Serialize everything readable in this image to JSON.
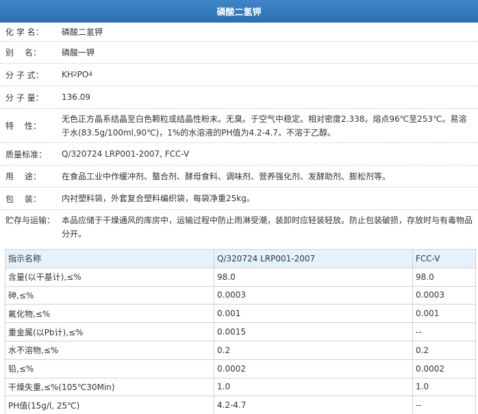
{
  "title": "磷酸二氢钾",
  "info": {
    "chem_name": {
      "label": "化 学 名：",
      "value": "磷酸二氢钾"
    },
    "alias": {
      "label": "别　 名：",
      "value": "磷酸一钾"
    },
    "formula": {
      "label": "分 子 式：",
      "kh": "KH",
      "sub1": "2",
      "po": "PO",
      "sub2": "4"
    },
    "mol_weight": {
      "label": "分 子 量：",
      "value": "136.09"
    },
    "properties": {
      "label": "特　 性：",
      "value": "无色正方晶系结晶至白色颗粒或结晶性粉末。无臭。于空气中稳定。相对密度2.338。熔点96℃至253℃。易溶于水(83.5g/100ml,90℃)，1%的水溶液的PH值为4.2-4.7。不溶于乙醇。"
    },
    "standard": {
      "label": "质量标准：",
      "value": "Q/320724 LRP001-2007, FCC-V"
    },
    "usage": {
      "label": "用　 途：",
      "value": "在食品工业中作缓冲剂、螯合剂、酵母食料、调味剂、营养强化剂、发酵助剂、膨松剂等。"
    },
    "packaging": {
      "label": "包　 装：",
      "value": "内衬塑料袋，外套复合塑料编织袋，每袋净重25kg。"
    },
    "storage": {
      "label": "贮存与运输：",
      "value": "本品应储于干燥通风的库房中，运输过程中防止雨淋受潮，装卸时应轻装轻放。防止包装破损，存放时与有毒物品分开。"
    }
  },
  "spec_table": {
    "headers": [
      "指示名称",
      "Q/320724 LRP001-2007",
      "FCC-V"
    ],
    "rows": [
      [
        "含量(以干基计),≤%",
        "98.0",
        "98.0"
      ],
      [
        "砷,≤%",
        "0.0003",
        "0.0003"
      ],
      [
        "氟化物,≤%",
        "0.001",
        "0.001"
      ],
      [
        "重金属(以Pb计),≤%",
        "0.0015",
        "--"
      ],
      [
        "水不溶物,≤%",
        "0.2",
        "0.2"
      ],
      [
        "铅,≤%",
        "0.0002",
        "0.0002"
      ],
      [
        "干燥失重,≤%(105℃30Min)",
        "1.0",
        "1.0"
      ],
      [
        "PH值(15g/l, 25℃)",
        "4.2-4.7",
        "--"
      ]
    ]
  }
}
